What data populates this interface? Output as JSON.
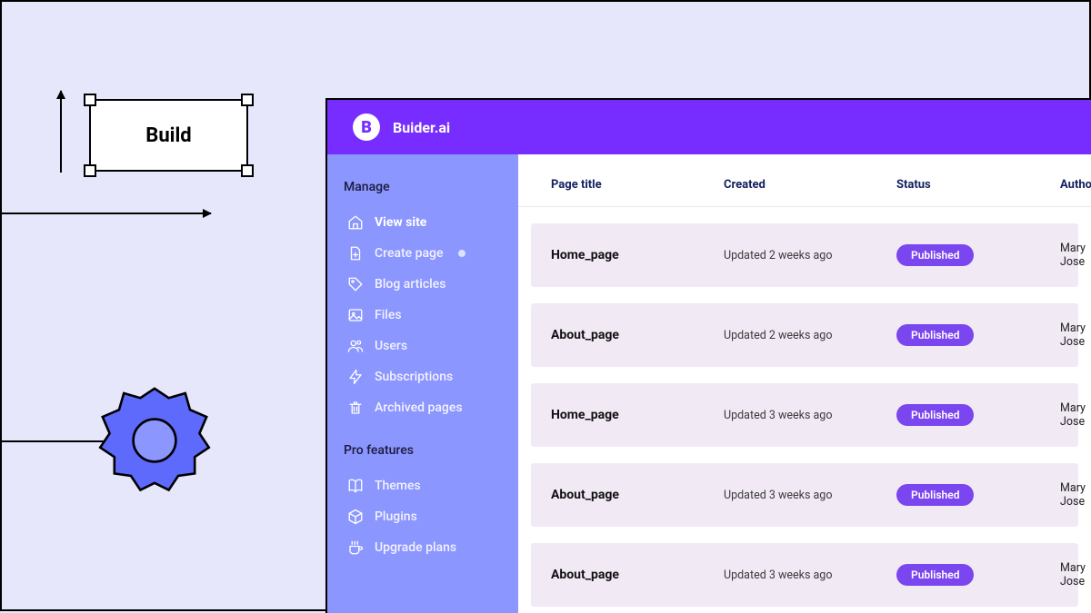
{
  "illustration": {
    "build_label": "Build"
  },
  "header": {
    "logo_glyph": "B",
    "app_name": "Buider.ai"
  },
  "sidebar": {
    "section_manage": "Manage",
    "section_pro": "Pro features",
    "items": [
      {
        "label": "View site"
      },
      {
        "label": "Create page"
      },
      {
        "label": "Blog articles"
      },
      {
        "label": "Files"
      },
      {
        "label": "Users"
      },
      {
        "label": "Subscriptions"
      },
      {
        "label": "Archived pages"
      }
    ],
    "pro_items": [
      {
        "label": "Themes"
      },
      {
        "label": "Plugins"
      },
      {
        "label": "Upgrade plans"
      }
    ]
  },
  "table": {
    "columns": {
      "page_title": "Page title",
      "created": "Created",
      "status": "Status",
      "author": "Author"
    },
    "rows": [
      {
        "title": "Home_page",
        "created": "Updated 2 weeks ago",
        "status": "Published",
        "author": "Mary Jose"
      },
      {
        "title": "About_page",
        "created": "Updated 2 weeks ago",
        "status": "Published",
        "author": "Mary Jose"
      },
      {
        "title": "Home_page",
        "created": "Updated 3 weeks ago",
        "status": "Published",
        "author": "Mary Jose"
      },
      {
        "title": "About_page",
        "created": "Updated 3 weeks ago",
        "status": "Published",
        "author": "Mary Jose"
      },
      {
        "title": "About_page",
        "created": "Updated 3 weeks ago",
        "status": "Published",
        "author": "Mary Jose"
      }
    ]
  }
}
